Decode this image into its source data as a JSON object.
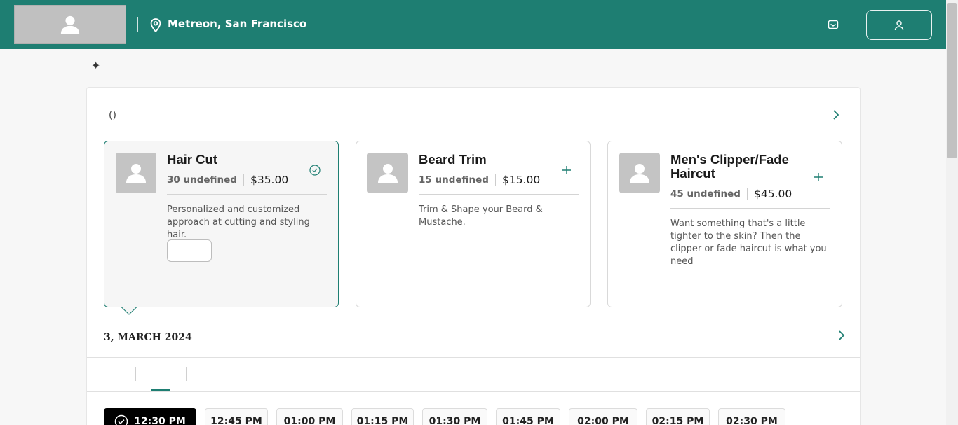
{
  "header": {
    "location": "Metreon, San Francisco",
    "colors": {
      "brand": "#1e7e72"
    }
  },
  "services": {
    "count_label": "()",
    "items": [
      {
        "title": "Hair Cut",
        "duration": "30 undefined",
        "price": "$35.00",
        "description": "Personalized and customized approach at cutting and styling hair.",
        "selected": true,
        "action_icon": "check-circle-icon"
      },
      {
        "title": "Beard Trim",
        "duration": "15 undefined",
        "price": "$15.00",
        "description": "Trim & Shape your Beard & Mustache.",
        "selected": false,
        "action_icon": "plus-icon"
      },
      {
        "title": "Men's Clipper/Fade Haircut",
        "duration": "45 undefined",
        "price": "$45.00",
        "description": "Want something that's a little tighter to the skin? Then the clipper or fade haircut is what you need",
        "selected": false,
        "action_icon": "plus-icon"
      }
    ]
  },
  "schedule": {
    "date": "3, MARCH 2024",
    "slots": [
      "12:30 PM",
      "12:45 PM",
      "01:00 PM",
      "01:15 PM",
      "01:30 PM",
      "01:45 PM",
      "02:00 PM",
      "02:15 PM",
      "02:30 PM"
    ],
    "selected_slot": "12:30 PM"
  }
}
